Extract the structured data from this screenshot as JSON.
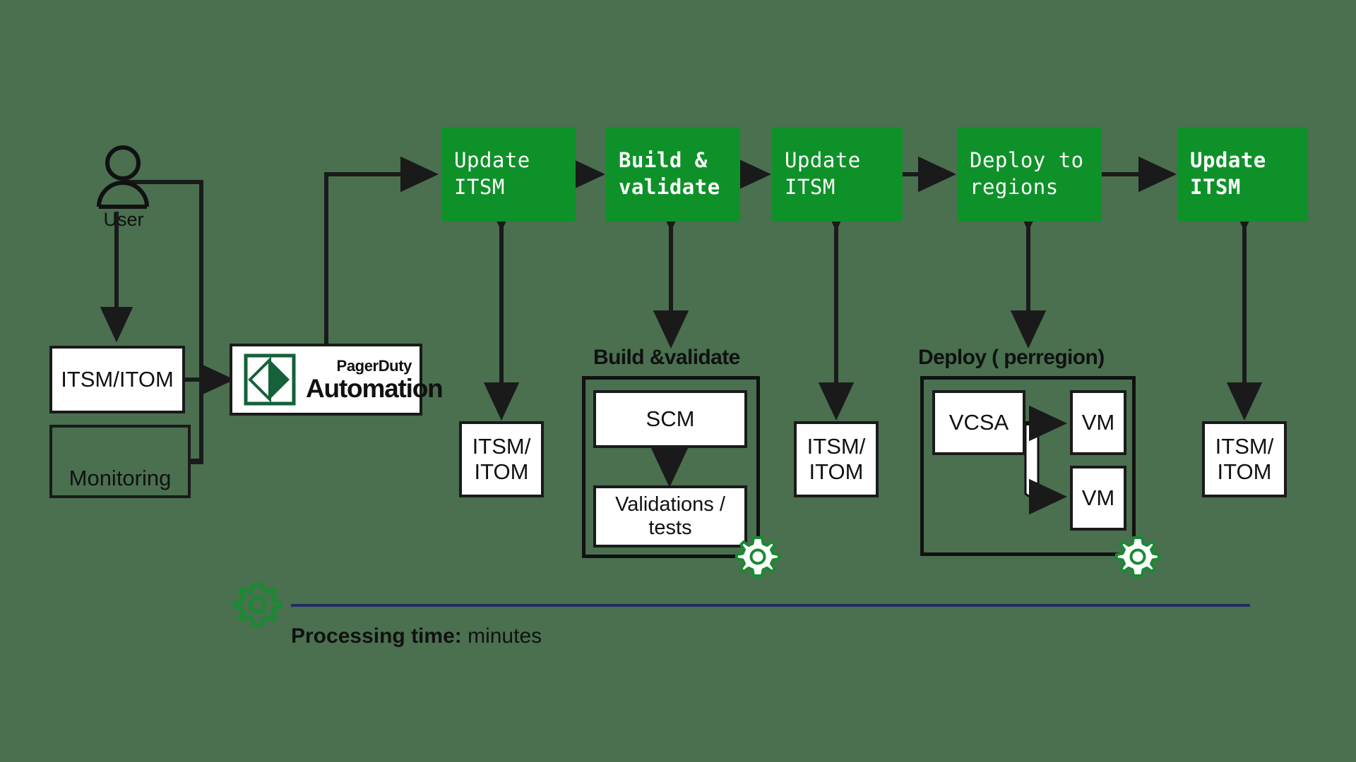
{
  "diagram": {
    "title": "PagerDuty Automation ITSM deployment workflow",
    "background_color": "#4a7050",
    "process_color": "#0e9129",
    "stroke_color": "#111111",
    "timeline_color": "#232b63",
    "gear_color": "#1a8a33"
  },
  "actors": {
    "user": {
      "label": "User",
      "icon": "user-icon"
    }
  },
  "left_systems": [
    {
      "id": "itsm-itom-source",
      "label": "ITSM/ITOM",
      "filled": true
    },
    {
      "id": "monitoring",
      "label": "Monitoring",
      "filled": false
    }
  ],
  "platform": {
    "brand_top": "PagerDuty",
    "brand_bottom": "Automation",
    "logo": "pagerduty-diamond-logo"
  },
  "pipeline": [
    {
      "id": "update-itsm-1",
      "label": "Update\nITSM",
      "bold": false
    },
    {
      "id": "build-validate",
      "label": "Build &\nvalidate",
      "bold": true
    },
    {
      "id": "update-itsm-2",
      "label": "Update\nITSM",
      "bold": false
    },
    {
      "id": "deploy-regions",
      "label": "Deploy to\nregions",
      "bold": false
    },
    {
      "id": "update-itsm-3",
      "label": "Update\nITSM",
      "bold": true
    }
  ],
  "itsm_sinks": [
    {
      "id": "itsm-sink-1",
      "label": "ITSM/\nITOM"
    },
    {
      "id": "itsm-sink-2",
      "label": "ITSM/\nITOM"
    },
    {
      "id": "itsm-sink-3",
      "label": "ITSM/\nITOM"
    }
  ],
  "build_group": {
    "label": "Build &validate",
    "steps": [
      {
        "id": "scm",
        "label": "SCM"
      },
      {
        "id": "validations-tests",
        "label": "Validations /\ntests"
      }
    ],
    "gear": "gear-icon"
  },
  "deploy_group": {
    "label": "Deploy ( perregion)",
    "source": {
      "id": "vcsa",
      "label": "VCSA"
    },
    "targets": [
      {
        "id": "vm-1",
        "label": "VM"
      },
      {
        "id": "vm-2",
        "label": "VM"
      }
    ],
    "gear": "gear-icon"
  },
  "timeline": {
    "gear": "gear-icon",
    "label_bold": "Processing time:",
    "label_rest": " minutes"
  }
}
